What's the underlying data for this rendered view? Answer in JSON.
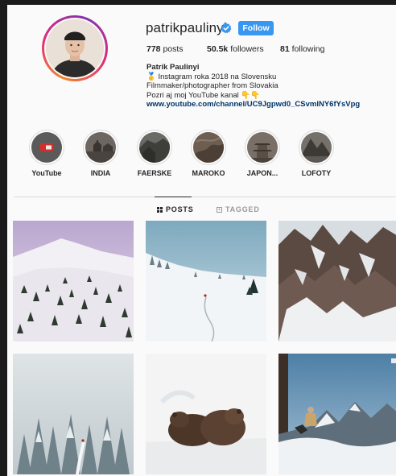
{
  "profile": {
    "username": "patrikpaulinyi",
    "follow_label": "Follow",
    "stats": {
      "posts_count": "778",
      "posts_label": "posts",
      "followers_count": "50.5k",
      "followers_label": "followers",
      "following_count": "81",
      "following_label": "following"
    },
    "bio": {
      "name": "Patrik Paulinyi",
      "line1": "🥇 Instagram roka 2018 na Slovensku",
      "line2": "Filmmaker/photographer from Slovakia",
      "line3": "Pozri aj moj YouTube kanal 👇👇",
      "link": "www.youtube.com/channel/UC9Jgpwd0_CSvmlNY6fYsVpg"
    }
  },
  "highlights": [
    {
      "label": "YouTube"
    },
    {
      "label": "INDIA"
    },
    {
      "label": "FAERSKE"
    },
    {
      "label": "MAROKO"
    },
    {
      "label": "JAPON..."
    },
    {
      "label": "LOFOTY"
    }
  ],
  "tabs": {
    "posts": "POSTS",
    "tagged": "TAGGED"
  },
  "colors": {
    "follow_button": "#3897f0",
    "link": "#003569",
    "verified": "#3897f0"
  }
}
